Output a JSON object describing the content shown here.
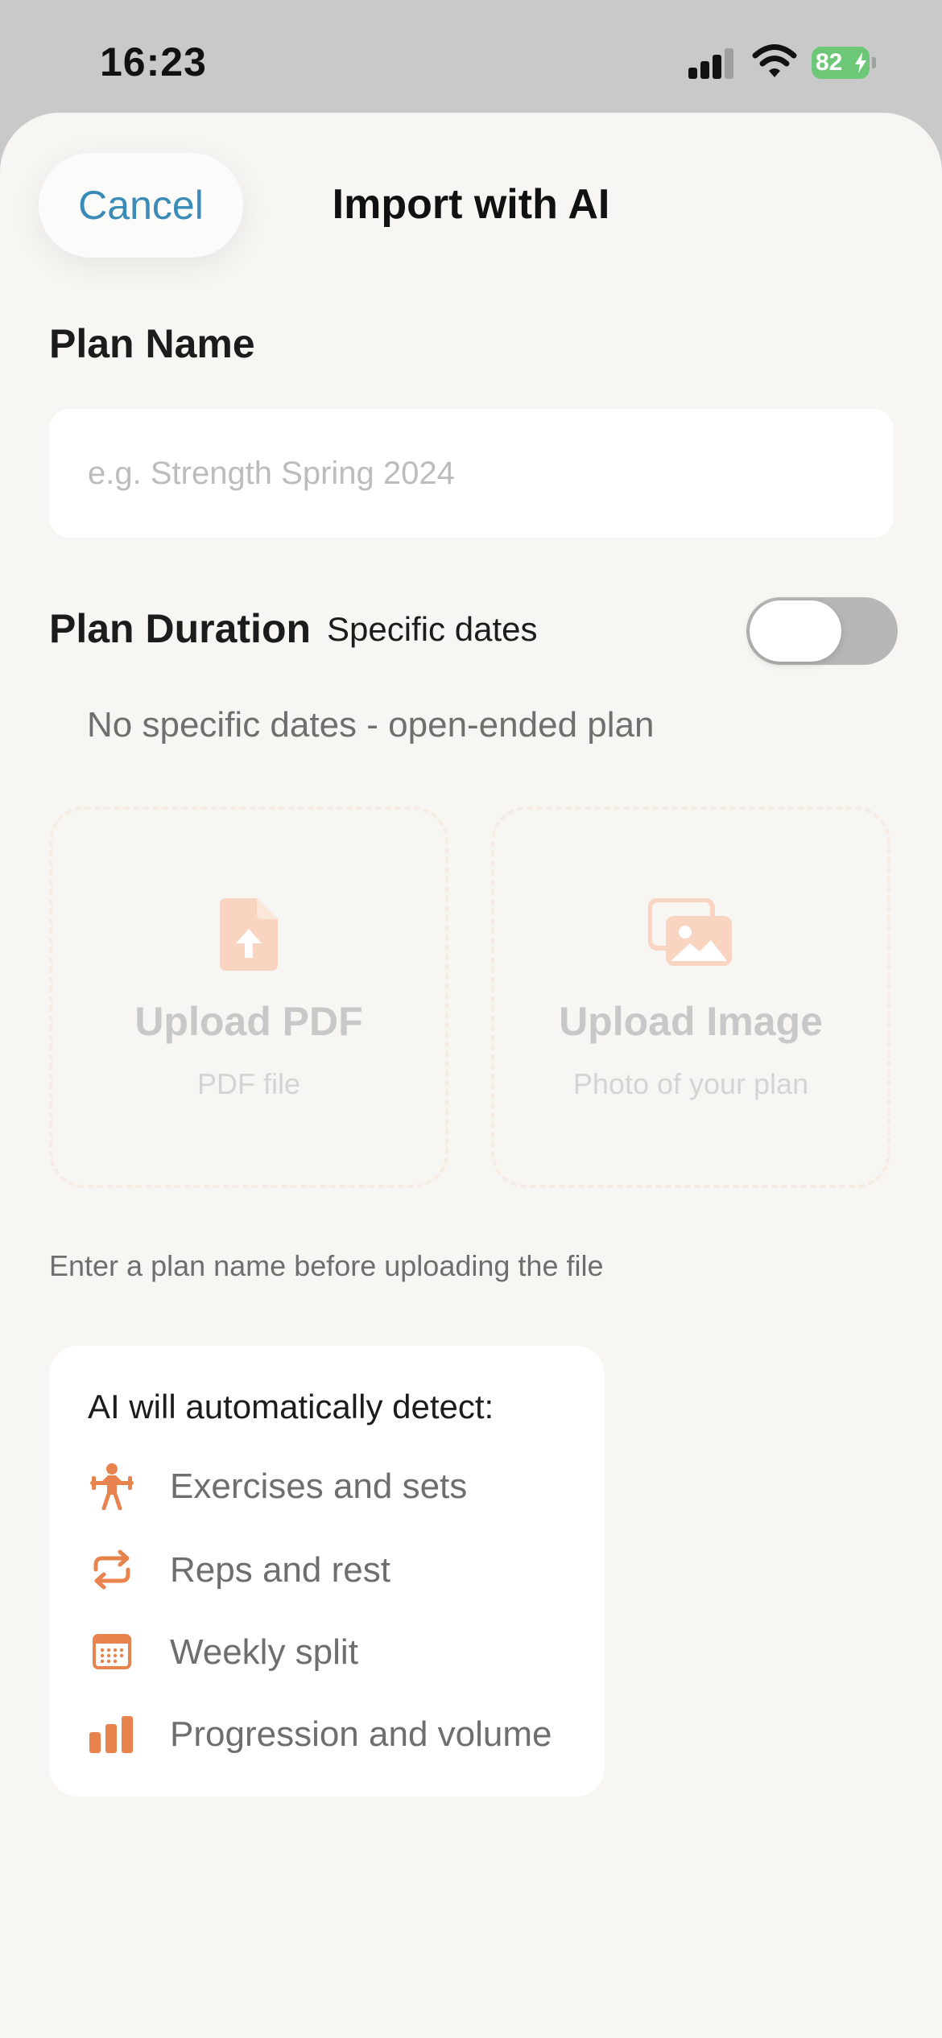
{
  "status_bar": {
    "time": "16:23",
    "battery": "82",
    "icons": [
      "cellular-signal-icon",
      "wifi-icon",
      "battery-charging-icon"
    ]
  },
  "header": {
    "cancel_label": "Cancel",
    "title": "Import with AI"
  },
  "form": {
    "plan_name_label": "Plan Name",
    "plan_name_placeholder": "e.g. Strength Spring 2024",
    "plan_name_value": "",
    "duration_label": "Plan Duration",
    "specific_dates_label": "Specific dates",
    "specific_dates_enabled": false,
    "duration_note": "No specific dates - open-ended plan"
  },
  "uploads": [
    {
      "title": "Upload PDF",
      "subtitle": "PDF file",
      "icon": "pdf-upload-icon"
    },
    {
      "title": "Upload Image",
      "subtitle": "Photo of your plan",
      "icon": "image-gallery-icon"
    }
  ],
  "hint": "Enter a plan name before uploading the file",
  "detect": {
    "title": "AI will automatically detect:",
    "items": [
      {
        "label": "Exercises and sets",
        "icon": "weightlifter-icon"
      },
      {
        "label": "Reps and rest",
        "icon": "repeat-arrows-icon"
      },
      {
        "label": "Weekly split",
        "icon": "calendar-icon"
      },
      {
        "label": "Progression and volume",
        "icon": "bar-chart-icon"
      }
    ]
  },
  "colors": {
    "accent_orange": "#e8834e",
    "link_blue": "#3a8bb8",
    "battery_green": "#6cc777",
    "sheet_bg": "#f7f6f3"
  }
}
